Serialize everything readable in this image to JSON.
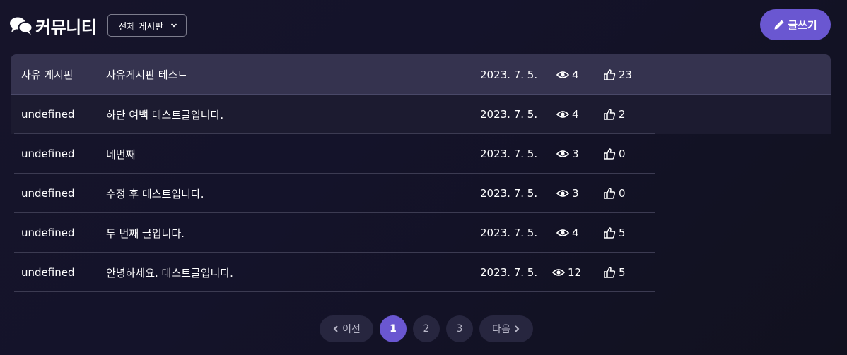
{
  "header": {
    "title": "커뮤니티",
    "board_select": "전체 게시판",
    "write_label": "글쓰기"
  },
  "posts": [
    {
      "board": "자유 게시판",
      "title": "자유게시판 테스트",
      "date": "2023. 7. 5.",
      "views": "4",
      "likes": "23"
    },
    {
      "board": "undefined",
      "title": "하단 여백 테스트글입니다.",
      "date": "2023. 7. 5.",
      "views": "4",
      "likes": "2"
    },
    {
      "board": "undefined",
      "title": "네번째",
      "date": "2023. 7. 5.",
      "views": "3",
      "likes": "0"
    },
    {
      "board": "undefined",
      "title": "수정 후 테스트입니다.",
      "date": "2023. 7. 5.",
      "views": "3",
      "likes": "0"
    },
    {
      "board": "undefined",
      "title": "두 번째 글입니다.",
      "date": "2023. 7. 5.",
      "views": "4",
      "likes": "5"
    },
    {
      "board": "undefined",
      "title": "안녕하세요. 테스트글입니다.",
      "date": "2023. 7. 5.",
      "views": "12",
      "likes": "5"
    }
  ],
  "pagination": {
    "prev": "이전",
    "next": "다음",
    "pages": [
      "1",
      "2",
      "3"
    ],
    "current": "1"
  },
  "colors": {
    "accent": "#6a57d1",
    "background": "#15142a",
    "header_row": "#35334f"
  }
}
